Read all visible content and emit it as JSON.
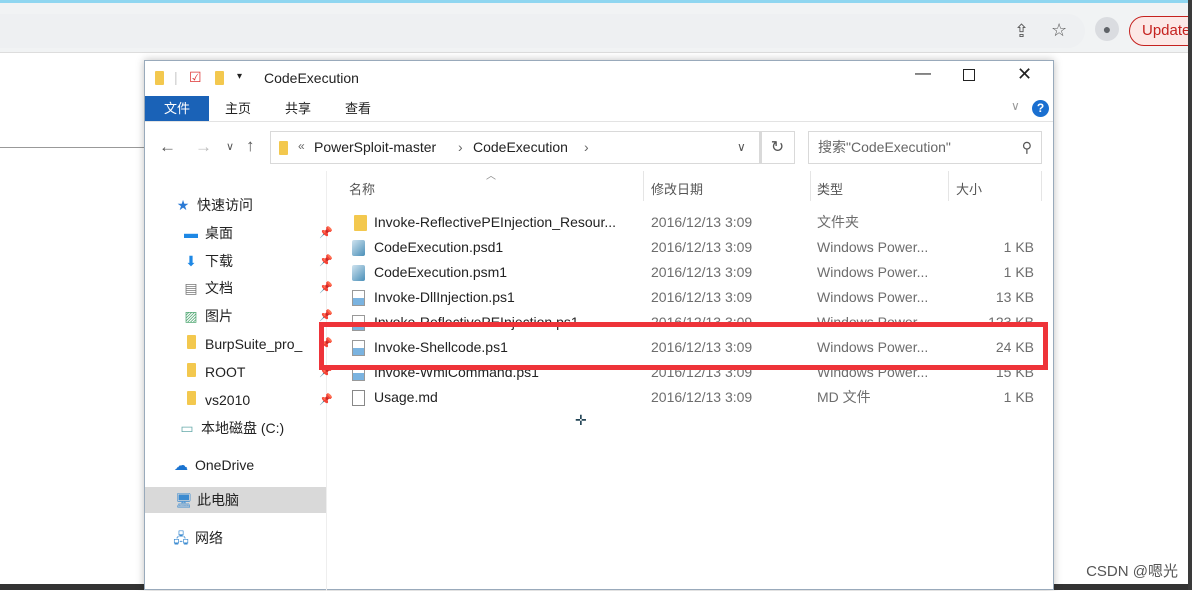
{
  "browser": {
    "update_label": "Update"
  },
  "window": {
    "title": "CodeExecution",
    "ribbon_tabs": [
      "文件",
      "主页",
      "共享",
      "查看"
    ],
    "breadcrumb": {
      "overflow": "«",
      "items": [
        "PowerSploit-master",
        "CodeExecution"
      ]
    },
    "search_placeholder": "搜索\"CodeExecution\"",
    "nav": {
      "quick_access": "快速访问",
      "items": [
        "桌面",
        "下载",
        "文档",
        "图片",
        "BurpSuite_pro_",
        "ROOT",
        "vs2010",
        "本地磁盘 (C:)"
      ],
      "onedrive": "OneDrive",
      "this_pc": "此电脑",
      "network": "网络"
    },
    "columns": [
      "名称",
      "修改日期",
      "类型",
      "大小"
    ],
    "files": [
      {
        "name": "Invoke-ReflectivePEInjection_Resour...",
        "date": "2016/12/13 3:09",
        "type": "文件夹",
        "size": "",
        "icon": "folder"
      },
      {
        "name": "CodeExecution.psd1",
        "date": "2016/12/13 3:09",
        "type": "Windows Power...",
        "size": "1 KB",
        "icon": "ps-module"
      },
      {
        "name": "CodeExecution.psm1",
        "date": "2016/12/13 3:09",
        "type": "Windows Power...",
        "size": "1 KB",
        "icon": "ps-module"
      },
      {
        "name": "Invoke-DllInjection.ps1",
        "date": "2016/12/13 3:09",
        "type": "Windows Power...",
        "size": "13 KB",
        "icon": "ps-script"
      },
      {
        "name": "Invoke-ReflectivePEInjection.ps1",
        "date": "2016/12/13 3:09",
        "type": "Windows Power...",
        "size": "123 KB",
        "icon": "ps-script"
      },
      {
        "name": "Invoke-Shellcode.ps1",
        "date": "2016/12/13 3:09",
        "type": "Windows Power...",
        "size": "24 KB",
        "icon": "ps-script"
      },
      {
        "name": "Invoke-WmiCommand.ps1",
        "date": "2016/12/13 3:09",
        "type": "Windows Power...",
        "size": "15 KB",
        "icon": "ps-script"
      },
      {
        "name": "Usage.md",
        "date": "2016/12/13 3:09",
        "type": "MD 文件",
        "size": "1 KB",
        "icon": "file"
      }
    ]
  },
  "watermark": "CSDN @嗯光",
  "colors": {
    "highlight": "#ee3339",
    "file_tab": "#1a62b7"
  }
}
